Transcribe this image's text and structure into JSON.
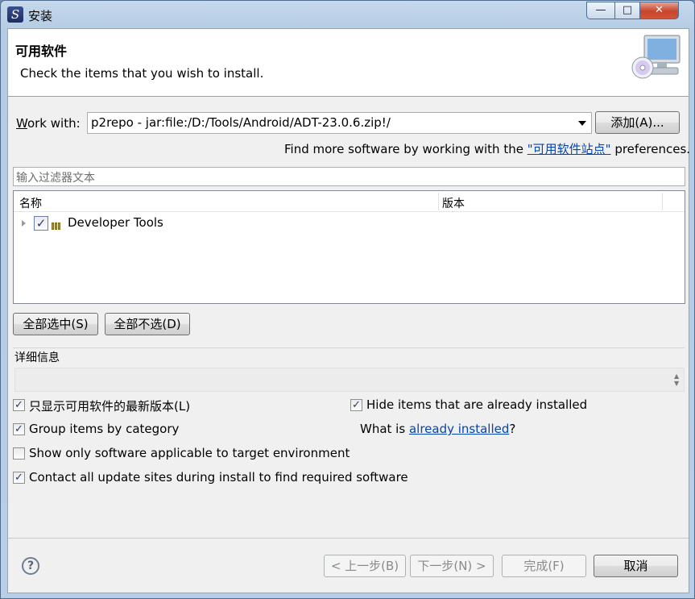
{
  "window": {
    "title": "安装",
    "minimize_glyph": "—",
    "maximize_glyph": "□",
    "close_glyph": "✕"
  },
  "banner": {
    "title": "可用软件",
    "description": "Check the items that you wish to install."
  },
  "work_with": {
    "label_mnemonic": "W",
    "label_rest": "ork with:",
    "value": "p2repo - jar:file:/D:/Tools/Android/ADT-23.0.6.zip!/",
    "add_button": "添加(A)..."
  },
  "find_more": {
    "prefix": "Find more software by working with the",
    "link": "\"可用软件站点\"",
    "suffix": "preferences."
  },
  "filter": {
    "placeholder": "输入过滤器文本"
  },
  "tree": {
    "columns": [
      "名称",
      "版本"
    ],
    "rows": [
      {
        "label": "Developer Tools",
        "checked": true,
        "version": ""
      }
    ]
  },
  "buttons": {
    "select_all": "全部选中(S)",
    "deselect_all": "全部不选(D)",
    "back": "< 上一步(B)",
    "next": "下一步(N) >",
    "finish": "完成(F)",
    "cancel": "取消"
  },
  "details": {
    "title": "详细信息"
  },
  "options": {
    "latest_only": {
      "label": "只显示可用软件的最新版本(L)",
      "checked": true
    },
    "group_by_category": {
      "label": "Group items by category",
      "checked": true
    },
    "applicable_only": {
      "label": "Show only software applicable to target environment",
      "checked": false
    },
    "contact_sites": {
      "label": "Contact all update sites during install to find required software",
      "checked": true
    },
    "hide_installed": {
      "label": "Hide items that are already installed",
      "checked": true
    }
  },
  "what_is": {
    "prefix": "What is",
    "link": "already installed",
    "suffix": "?"
  },
  "help": {
    "glyph": "?"
  },
  "check_glyph": "✓",
  "colors": {
    "link": "#0645ad",
    "title_bar": "#b9cee6",
    "dialog_bg": "#f0f0f0"
  }
}
